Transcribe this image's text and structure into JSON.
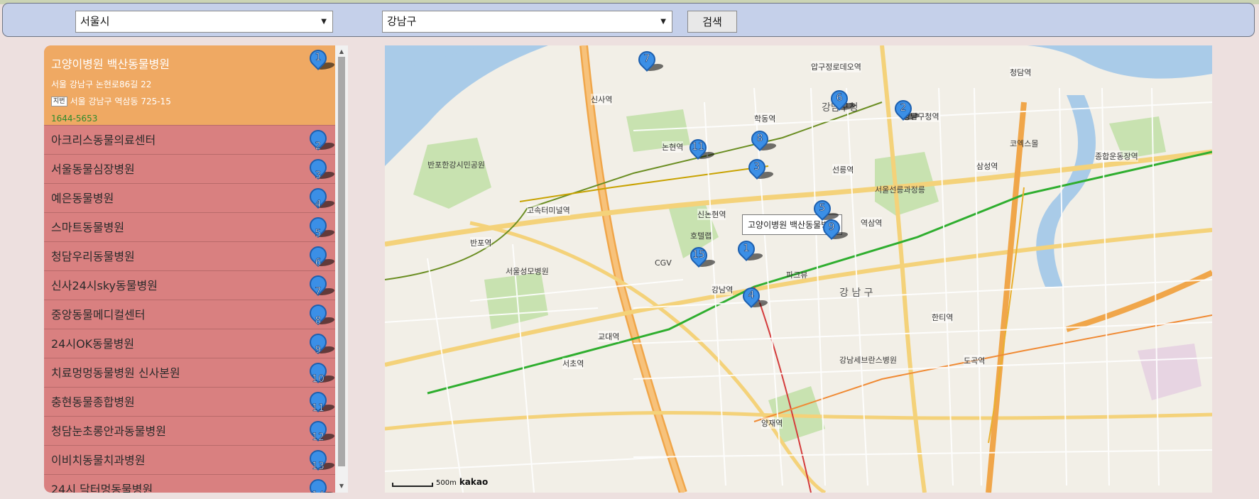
{
  "search": {
    "city": "서울시",
    "district": "강남구",
    "button": "검색"
  },
  "list": {
    "selected": {
      "number": "1",
      "name": "고양이병원 백산동물병원",
      "road_address": "서울 강남구 논현로86길 22",
      "jibun_badge": "지번",
      "jibun_address": "서울 강남구 역삼동 725-15",
      "phone": "1644-5653"
    },
    "items": [
      {
        "number": "2",
        "name": "아크리스동물의료센터"
      },
      {
        "number": "3",
        "name": "서울동물심장병원"
      },
      {
        "number": "4",
        "name": "예은동물병원"
      },
      {
        "number": "5",
        "name": "스마트동물병원"
      },
      {
        "number": "6",
        "name": "청담우리동물병원"
      },
      {
        "number": "7",
        "name": "신사24시sky동물병원"
      },
      {
        "number": "8",
        "name": "중앙동물메디컬센터"
      },
      {
        "number": "9",
        "name": "24시OK동물병원"
      },
      {
        "number": "10",
        "name": "치료멍멍동물병원 신사본원"
      },
      {
        "number": "11",
        "name": "충현동물종합병원"
      },
      {
        "number": "12",
        "name": "청담눈초롱안과동물병원"
      },
      {
        "number": "13",
        "name": "이비치동물치과병원"
      },
      {
        "number": "14",
        "name": "24시 닥터멍동물병원"
      }
    ]
  },
  "map": {
    "tooltip": "고양이병원 백산동물병원",
    "scale": "500m",
    "logo": "kakao",
    "markers": [
      "1",
      "2",
      "3",
      "4",
      "5",
      "6",
      "7",
      "8",
      "9",
      "11",
      "15"
    ],
    "labels": {
      "gangnamgu_office": "강남구청",
      "gangnam_gu": "강 남 구",
      "gangnam_station": "강남역",
      "yeoksam_station": "역삼역",
      "sinsa_station": "신사역",
      "nonhyeon_station": "논현역",
      "hakdong_station": "학동역",
      "gangnamgu_station": "강남구청역",
      "seolleung_station": "선릉역",
      "samseong_station": "삼성역",
      "sports_station": "종합운동장역",
      "sinnonhyeon_station": "신논현역",
      "express_terminal": "고속터미널역",
      "gyodae_station": "교대역",
      "seocho_station": "서초역",
      "yangjae_station": "양재역",
      "dogok_station": "도곡역",
      "hanti_station": "한티역",
      "cheongdam_station": "청담역",
      "sinsa_cheongdam": "압구정로데오역",
      "banpo_station": "반포역",
      "banpo_hangang": "반포한강시민공원",
      "seoul_forest": "서울선릉과정릉",
      "coex": "코엑스몰",
      "gangnam_severance": "강남세브란스병원",
      "seoul_st_mary": "서울성모병원",
      "cgv": "CGV",
      "hotel": "호텔랩",
      "parkview": "파크뷰"
    }
  },
  "colors": {
    "list_bg": "#d98080",
    "selected_bg": "#efa963",
    "phone": "#2d8b2d",
    "pin": "#3b8fe6",
    "search_bar": "#c5d0ea"
  }
}
